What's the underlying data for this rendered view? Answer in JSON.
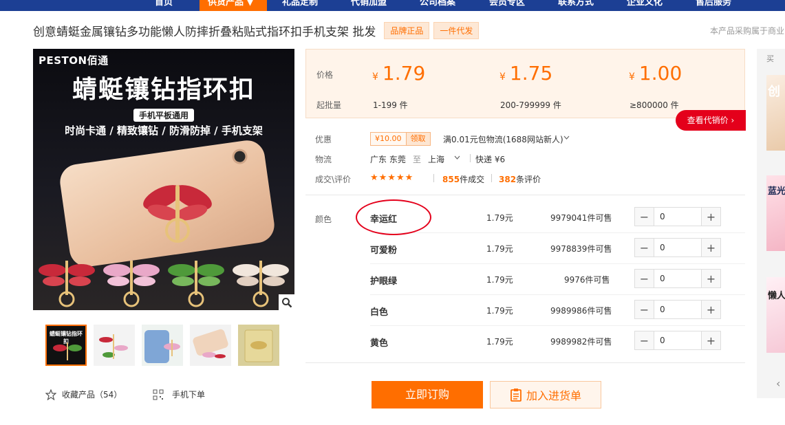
{
  "nav": {
    "items": [
      "首页",
      "供货产品",
      "礼品定制",
      "代销加盟",
      "公司档案",
      "会员专区",
      "联系方式",
      "企业文化",
      "售后服务"
    ],
    "active_caret": "▼"
  },
  "product": {
    "title": "创意蜻蜓金属镶钻多功能懒人防摔折叠粘贴式指环扣手机支架 批发",
    "tags": [
      "品牌正品",
      "一件代发"
    ],
    "procurement_note": "本产品采购属于商业"
  },
  "main_image": {
    "brand": "PESTON佰通",
    "headline": "蜻蜓镶钻指环扣",
    "badge": "手机平板通用",
    "features": "时尚卡通 / 精致镶钻 / 防滑防掉 / 手机支架"
  },
  "thumbnails": {
    "first_title": "蜻蜓镶钻指环扣"
  },
  "favorite": {
    "label": "收藏产品",
    "count": "（54）"
  },
  "mobile_order": {
    "label": "手机下单"
  },
  "pricing": {
    "price_label": "价格",
    "moq_label": "起批量",
    "currency": "¥",
    "tiers": [
      {
        "price": "1.79",
        "range": "1-199 件"
      },
      {
        "price": "1.75",
        "range": "200-799999 件"
      },
      {
        "price": "1.00",
        "range": "≥800000 件"
      }
    ],
    "agent_button": "查看代销价"
  },
  "promo": {
    "label": "优惠",
    "coupon_amount": "¥10.00",
    "coupon_action": "领取",
    "text": "满0.01元包物流(1688网站新人)"
  },
  "logistics": {
    "label": "物流",
    "from": "广东 东莞",
    "to_word": "至",
    "to": "上海",
    "express": "快递 ¥6"
  },
  "reviews": {
    "label": "成交\\评价",
    "stars": "★★★★★",
    "deals_count": "855",
    "deals_suffix": "件成交",
    "review_count": "382",
    "review_suffix": "条评价"
  },
  "sku": {
    "label": "颜色",
    "rows": [
      {
        "name": "幸运红",
        "price": "1.79元",
        "stock": "9979041件可售",
        "qty": "0"
      },
      {
        "name": "可爱粉",
        "price": "1.79元",
        "stock": "9978839件可售",
        "qty": "0"
      },
      {
        "name": "护眼绿",
        "price": "1.79元",
        "stock": "9976件可售",
        "qty": "0"
      },
      {
        "name": "白色",
        "price": "1.79元",
        "stock": "9989986件可售",
        "qty": "0"
      },
      {
        "name": "黄色",
        "price": "1.79元",
        "stock": "9989982件可售",
        "qty": "0"
      }
    ]
  },
  "actions": {
    "buy_now": "立即订购",
    "add_to_list": "加入进货单"
  },
  "right_column": {
    "label": "买",
    "item_texts": [
      "创",
      "蓝光",
      "懒人"
    ]
  },
  "colors": {
    "nav_bg": "#1c3f94",
    "accent": "#ff6e00",
    "red": "#e4001b"
  }
}
